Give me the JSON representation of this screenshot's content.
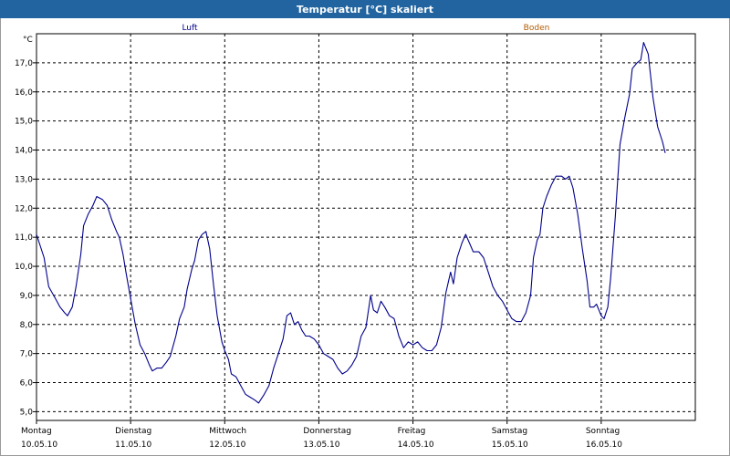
{
  "window": {
    "title": "Temperatur [°C] skaliert"
  },
  "chart_data": {
    "type": "line",
    "title": "Temperatur [°C] skaliert",
    "ylabel": "°C",
    "xlabel": "",
    "ylim": [
      5.0,
      17.0
    ],
    "ylim_extended": [
      4.7,
      18.0
    ],
    "yticks": [
      "5,0",
      "6,0",
      "7,0",
      "8,0",
      "9,0",
      "10,0",
      "11,0",
      "12,0",
      "13,0",
      "14,0",
      "15,0",
      "16,0",
      "17,0"
    ],
    "xticks": [
      {
        "day": "Montag",
        "date": "10.05.10"
      },
      {
        "day": "Dienstag",
        "date": "11.05.10"
      },
      {
        "day": "Mittwoch",
        "date": "12.05.10"
      },
      {
        "day": "Donnerstag",
        "date": "13.05.10"
      },
      {
        "day": "Freitag",
        "date": "14.05.10"
      },
      {
        "day": "Samstag",
        "date": "15.05.10"
      },
      {
        "day": "Sonntag",
        "date": "16.05.10"
      }
    ],
    "grid": true,
    "legend": [
      {
        "name": "Luft",
        "color": "#00008b"
      },
      {
        "name": "Boden",
        "color": "#b15a00"
      }
    ],
    "series": [
      {
        "name": "Luft",
        "color": "#00008b",
        "points": [
          [
            0.0,
            11.1
          ],
          [
            0.08,
            10.3
          ],
          [
            0.13,
            9.3
          ],
          [
            0.2,
            8.9
          ],
          [
            0.25,
            8.6
          ],
          [
            0.3,
            8.4
          ],
          [
            0.33,
            8.3
          ],
          [
            0.38,
            8.6
          ],
          [
            0.42,
            9.3
          ],
          [
            0.47,
            10.4
          ],
          [
            0.5,
            11.4
          ],
          [
            0.55,
            11.8
          ],
          [
            0.6,
            12.1
          ],
          [
            0.64,
            12.4
          ],
          [
            0.7,
            12.3
          ],
          [
            0.75,
            12.1
          ],
          [
            0.8,
            11.6
          ],
          [
            0.85,
            11.2
          ],
          [
            0.88,
            11.0
          ],
          [
            0.92,
            10.4
          ],
          [
            0.95,
            9.8
          ],
          [
            1.0,
            8.9
          ],
          [
            1.05,
            8.0
          ],
          [
            1.1,
            7.3
          ],
          [
            1.15,
            7.0
          ],
          [
            1.2,
            6.6
          ],
          [
            1.23,
            6.4
          ],
          [
            1.28,
            6.5
          ],
          [
            1.33,
            6.5
          ],
          [
            1.38,
            6.7
          ],
          [
            1.42,
            6.9
          ],
          [
            1.48,
            7.6
          ],
          [
            1.52,
            8.2
          ],
          [
            1.57,
            8.6
          ],
          [
            1.6,
            9.2
          ],
          [
            1.65,
            9.9
          ],
          [
            1.68,
            10.2
          ],
          [
            1.72,
            10.9
          ],
          [
            1.76,
            11.1
          ],
          [
            1.8,
            11.2
          ],
          [
            1.84,
            10.6
          ],
          [
            1.88,
            9.4
          ],
          [
            1.92,
            8.3
          ],
          [
            1.97,
            7.4
          ],
          [
            2.0,
            7.1
          ],
          [
            2.04,
            6.8
          ],
          [
            2.07,
            6.3
          ],
          [
            2.12,
            6.2
          ],
          [
            2.17,
            5.9
          ],
          [
            2.22,
            5.6
          ],
          [
            2.27,
            5.5
          ],
          [
            2.32,
            5.4
          ],
          [
            2.36,
            5.3
          ],
          [
            2.42,
            5.6
          ],
          [
            2.47,
            5.9
          ],
          [
            2.52,
            6.5
          ],
          [
            2.57,
            7.0
          ],
          [
            2.62,
            7.5
          ],
          [
            2.66,
            8.3
          ],
          [
            2.7,
            8.4
          ],
          [
            2.74,
            8.0
          ],
          [
            2.78,
            8.1
          ],
          [
            2.82,
            7.8
          ],
          [
            2.86,
            7.6
          ],
          [
            2.9,
            7.6
          ],
          [
            2.95,
            7.5
          ],
          [
            3.0,
            7.3
          ],
          [
            3.05,
            7.0
          ],
          [
            3.1,
            6.9
          ],
          [
            3.15,
            6.8
          ],
          [
            3.2,
            6.5
          ],
          [
            3.25,
            6.3
          ],
          [
            3.3,
            6.4
          ],
          [
            3.35,
            6.6
          ],
          [
            3.4,
            6.9
          ],
          [
            3.45,
            7.6
          ],
          [
            3.5,
            7.9
          ],
          [
            3.55,
            9.0
          ],
          [
            3.58,
            8.5
          ],
          [
            3.62,
            8.4
          ],
          [
            3.66,
            8.8
          ],
          [
            3.7,
            8.6
          ],
          [
            3.75,
            8.3
          ],
          [
            3.8,
            8.2
          ],
          [
            3.85,
            7.6
          ],
          [
            3.9,
            7.2
          ],
          [
            3.95,
            7.4
          ],
          [
            4.0,
            7.3
          ],
          [
            4.05,
            7.4
          ],
          [
            4.1,
            7.2
          ],
          [
            4.15,
            7.1
          ],
          [
            4.2,
            7.1
          ],
          [
            4.25,
            7.3
          ],
          [
            4.3,
            7.9
          ],
          [
            4.35,
            9.1
          ],
          [
            4.4,
            9.8
          ],
          [
            4.43,
            9.4
          ],
          [
            4.47,
            10.3
          ],
          [
            4.52,
            10.8
          ],
          [
            4.56,
            11.1
          ],
          [
            4.6,
            10.8
          ],
          [
            4.64,
            10.5
          ],
          [
            4.7,
            10.5
          ],
          [
            4.75,
            10.3
          ],
          [
            4.8,
            9.8
          ],
          [
            4.85,
            9.3
          ],
          [
            4.9,
            9.0
          ],
          [
            4.95,
            8.8
          ],
          [
            5.0,
            8.5
          ],
          [
            5.05,
            8.2
          ],
          [
            5.1,
            8.1
          ],
          [
            5.15,
            8.1
          ],
          [
            5.2,
            8.4
          ],
          [
            5.25,
            9.0
          ],
          [
            5.28,
            10.3
          ],
          [
            5.32,
            10.9
          ],
          [
            5.35,
            11.1
          ],
          [
            5.38,
            12.0
          ],
          [
            5.42,
            12.4
          ],
          [
            5.47,
            12.8
          ],
          [
            5.52,
            13.1
          ],
          [
            5.58,
            13.1
          ],
          [
            5.62,
            13.0
          ],
          [
            5.66,
            13.1
          ],
          [
            5.7,
            12.7
          ],
          [
            5.75,
            11.8
          ],
          [
            5.8,
            10.6
          ],
          [
            5.85,
            9.5
          ],
          [
            5.88,
            8.6
          ],
          [
            5.92,
            8.6
          ],
          [
            5.95,
            8.7
          ],
          [
            6.0,
            8.3
          ],
          [
            6.03,
            8.2
          ],
          [
            6.07,
            8.6
          ],
          [
            6.1,
            9.6
          ],
          [
            6.15,
            11.7
          ],
          [
            6.2,
            14.2
          ],
          [
            6.25,
            15.1
          ],
          [
            6.3,
            15.9
          ],
          [
            6.33,
            16.8
          ],
          [
            6.38,
            17.0
          ],
          [
            6.42,
            17.1
          ],
          [
            6.45,
            17.7
          ],
          [
            6.5,
            17.3
          ],
          [
            6.55,
            15.8
          ],
          [
            6.6,
            14.8
          ],
          [
            6.65,
            14.3
          ],
          [
            6.68,
            13.9
          ]
        ]
      }
    ]
  }
}
